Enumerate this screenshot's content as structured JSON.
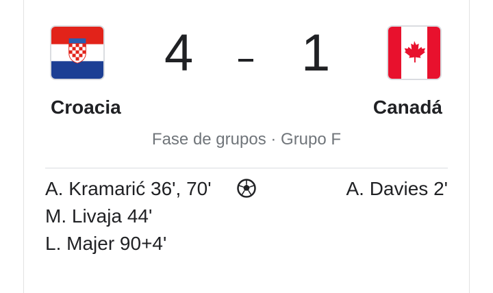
{
  "match": {
    "home": {
      "name": "Croacia",
      "score": "4",
      "flag_icon": "croatia-flag-icon"
    },
    "away": {
      "name": "Canadá",
      "score": "1",
      "flag_icon": "canada-flag-icon"
    },
    "separator": "-",
    "stage": "Fase de grupos · Grupo F",
    "home_scorers": [
      "A. Kramarić 36', 70'",
      "M. Livaja 44'",
      "L. Majer 90+4'"
    ],
    "away_scorers": [
      "A. Davies 2'"
    ],
    "goal_icon": "soccer-ball-icon"
  },
  "colors": {
    "croatia_red": "#e2231a",
    "croatia_blue": "#1c3f94",
    "canada_red": "#e8112d",
    "text": "#202124",
    "muted": "#70757a"
  }
}
